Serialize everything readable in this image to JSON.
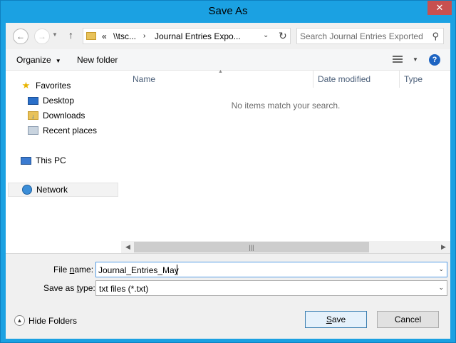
{
  "window": {
    "title": "Save As",
    "close_glyph": "✕"
  },
  "address": {
    "prefix": "«",
    "segments": [
      "\\\\tsc...",
      "Journal Entries Expo..."
    ],
    "separator": "›"
  },
  "search": {
    "placeholder": "Search Journal Entries Exported"
  },
  "toolbar": {
    "organize_label": "Organize",
    "new_folder_label": "New folder",
    "help_glyph": "?"
  },
  "navpane": {
    "favorites": "Favorites",
    "desktop": "Desktop",
    "downloads": "Downloads",
    "recent": "Recent places",
    "thispc": "This PC",
    "network": "Network"
  },
  "filelist": {
    "columns": [
      "Name",
      "Date modified",
      "Type"
    ],
    "empty_message": "No items match your search."
  },
  "form": {
    "filename_label_pre": "File ",
    "filename_label_ul": "n",
    "filename_label_post": "ame:",
    "filename_value": "Journal_Entries_May",
    "savetype_label_pre": "Save as ",
    "savetype_label_ul": "t",
    "savetype_label_post": "ype:",
    "savetype_value": "txt files (*.txt)"
  },
  "buttons": {
    "hide_folders": "Hide Folders",
    "save_ul": "S",
    "save_rest": "ave",
    "cancel": "Cancel"
  },
  "colors": {
    "titlebar": "#1ba1e2",
    "close_button": "#c75050",
    "accent_border": "#569de5",
    "column_header_text": "#4c607a"
  }
}
